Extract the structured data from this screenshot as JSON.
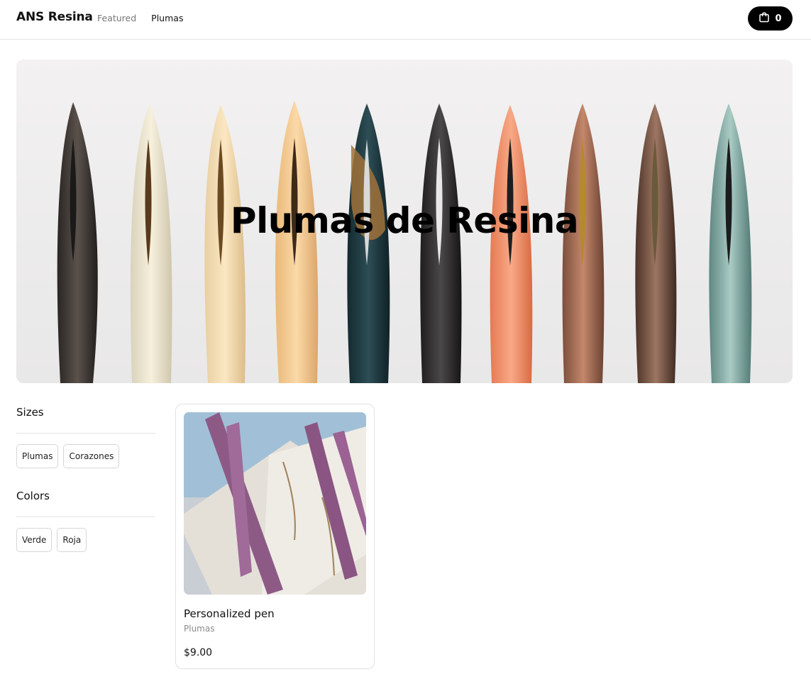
{
  "header": {
    "brand": "ANS Resina",
    "nav": [
      "Featured",
      "Plumas"
    ],
    "cart_count": "0"
  },
  "hero": {
    "title": "Plumas de Resina"
  },
  "filters": {
    "sizes": {
      "title": "Sizes",
      "options": [
        "Plumas",
        "Corazones"
      ]
    },
    "colors": {
      "title": "Colors",
      "options": [
        "Verde",
        "Roja"
      ]
    }
  },
  "products": [
    {
      "name": "Personalized pen",
      "category": "Plumas",
      "price": "$9.00"
    }
  ],
  "colors": {
    "accent": "#000000",
    "border": "#e2e2e2",
    "muted_text": "#777777"
  }
}
